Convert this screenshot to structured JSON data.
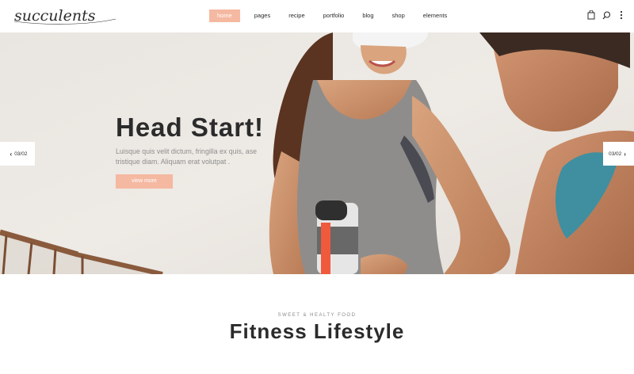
{
  "brand": {
    "logo_text": "succulents"
  },
  "nav": {
    "items": [
      {
        "label": "home",
        "active": true
      },
      {
        "label": "pages"
      },
      {
        "label": "recipe"
      },
      {
        "label": "portfolio"
      },
      {
        "label": "blog"
      },
      {
        "label": "shop"
      },
      {
        "label": "elements"
      }
    ]
  },
  "header_icons": [
    "cart-icon",
    "search-icon",
    "more-vertical-icon"
  ],
  "hero": {
    "title": "Head Start!",
    "text": "Luisque quis velit dictum, fringilla ex quis, ase tristique diam. Aliquam erat volutpat .",
    "button_label": "view more",
    "prev_label": "03/02",
    "next_label": "03/02"
  },
  "section": {
    "subtitle": "SWEET & HEALTY FOOD",
    "title": "Fitness Lifestyle"
  },
  "colors": {
    "accent": "#f5b8a1",
    "text": "#2b2b2b",
    "muted": "#8f8f8f"
  }
}
